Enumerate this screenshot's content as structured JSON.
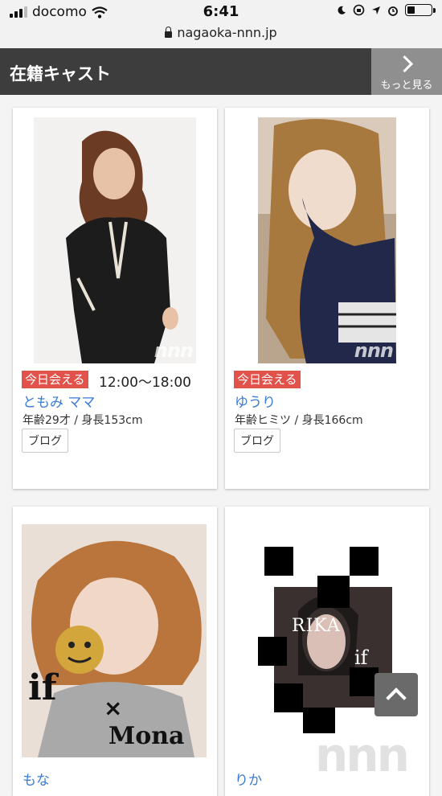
{
  "status_bar": {
    "carrier": "docomo",
    "time": "6:41",
    "url": "nagaoka-nnn.jp"
  },
  "header": {
    "title": "在籍キャスト",
    "more_label": "もっと見る"
  },
  "casts": [
    {
      "badge": "今日会える",
      "hours": "12:00〜18:00",
      "name": "ともみ ママ",
      "stats": "年齢29才 / 身長153cm",
      "blog": "ブログ"
    },
    {
      "badge": "今日会える",
      "hours": "",
      "name": "ゆうり",
      "stats": "年齢ヒミツ / 身長166cm",
      "blog": "ブログ"
    },
    {
      "name": "もな",
      "photo_text": [
        "if",
        "×",
        "Mona"
      ]
    },
    {
      "name": "りか",
      "photo_text": [
        "RIKA",
        "if"
      ]
    }
  ],
  "watermark": "nnn",
  "colors": {
    "header_bg": "#3d3d3d",
    "badge": "#e0524a",
    "link": "#3a7bd5"
  }
}
